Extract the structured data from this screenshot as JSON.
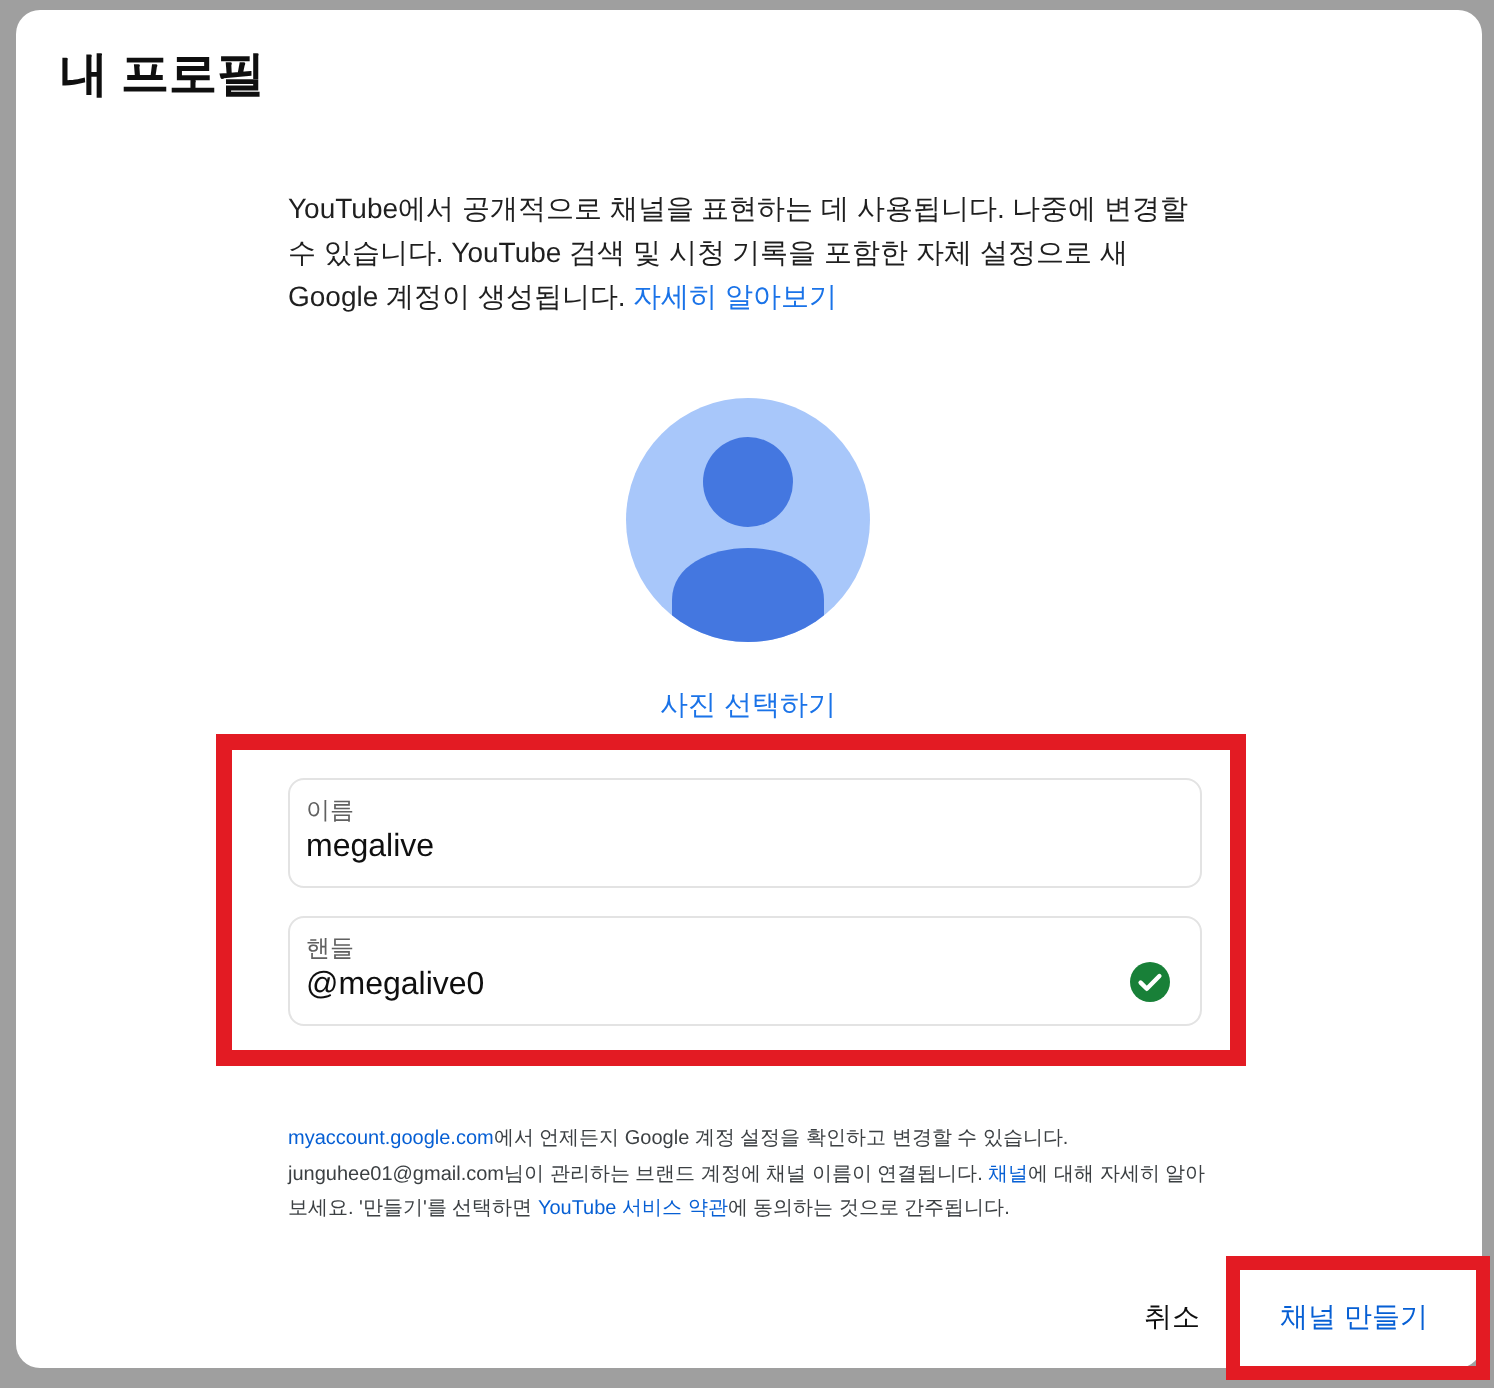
{
  "dialog": {
    "title": "내 프로필"
  },
  "description": [
    {
      "kind": "text",
      "text": "YouTube에서 공개적으로 채널을 표현하는 데 사용됩니다. 나중에 변경할 수 있습니다. YouTube 검색 및 시청 기록을 포함한 자체 설정으로 새 Google 계정이 생성됩니다. "
    },
    {
      "kind": "link",
      "text": "자세히 알아보기"
    }
  ],
  "photo": {
    "action": "사진 선택하기"
  },
  "form": {
    "highlighted": true,
    "fields": [
      {
        "label": "이름",
        "value": "megalive",
        "valid": false
      },
      {
        "label": "핸들",
        "value": "@megalive0",
        "valid": true
      }
    ]
  },
  "notice": [
    [
      {
        "kind": "link",
        "text": "myaccount.google.com"
      },
      {
        "kind": "text",
        "text": "에서 언제든지 Google 계정 설정을 확인하고 변경할 수 있습니다."
      }
    ],
    [
      {
        "kind": "text",
        "text": "junguhee01@gmail.com님이 관리하는 브랜드 계정에 채널 이름이 연결됩니다. "
      },
      {
        "kind": "link",
        "text": "채널"
      },
      {
        "kind": "text",
        "text": "에 대해 자세히 알아보세요. '만들기'를 선택하면 "
      },
      {
        "kind": "link",
        "text": "YouTube 서비스 약관"
      },
      {
        "kind": "text",
        "text": "에 동의하는 것으로 간주됩니다."
      }
    ]
  ],
  "buttons": [
    {
      "label": "취소",
      "kind": "secondary",
      "highlighted": false
    },
    {
      "label": "채널 만들기",
      "kind": "primary",
      "highlighted": true
    }
  ]
}
